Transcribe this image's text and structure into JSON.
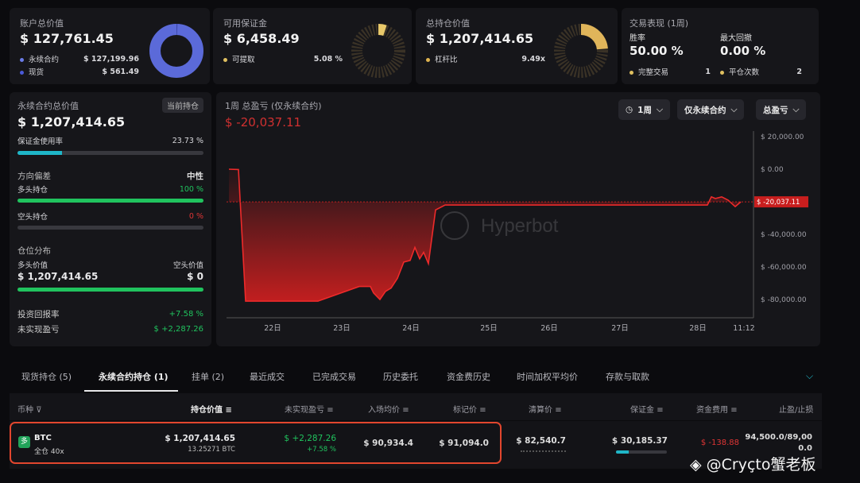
{
  "summary": {
    "account": {
      "title": "账户总价值",
      "value": "$ 127,761.45",
      "rows": [
        {
          "label": "永续合约",
          "value": "$ 127,199.96",
          "color": "#6a7ce8"
        },
        {
          "label": "现货",
          "value": "$ 561.49",
          "color": "#4a5ad8"
        }
      ]
    },
    "margin": {
      "title": "可用保证金",
      "value": "$ 6,458.49",
      "rows": [
        {
          "label": "可提取",
          "value": "5.08 %",
          "color": "#e0c060"
        }
      ]
    },
    "positions": {
      "title": "总持仓价值",
      "value": "$ 1,207,414.65",
      "rows": [
        {
          "label": "杠杆比",
          "value": "9.49x",
          "color": "#e0b450"
        }
      ]
    },
    "performance": {
      "title": "交易表现 (1周)",
      "win_label": "胜率",
      "win_value": "50.00 %",
      "dd_label": "最大回撤",
      "dd_value": "0.00 %",
      "completed_label": "完整交易",
      "completed_value": "1",
      "close_label": "平仓次数",
      "close_value": "2"
    }
  },
  "perp": {
    "title": "永续合约总价值",
    "badge": "当前持仓",
    "value": "$ 1,207,414.65",
    "margin_usage_label": "保证金使用率",
    "margin_usage_value": "23.73 %",
    "margin_usage_fraction": 0.2373,
    "bias_label": "方向偏差",
    "bias_value": "中性",
    "long_label": "多头持仓",
    "long_value": "100 %",
    "long_fraction": 1.0,
    "short_label": "空头持仓",
    "short_value": "0 %",
    "short_fraction": 0.0,
    "dist_label": "仓位分布",
    "long_val_label": "多头价值",
    "short_val_label": "空头价值",
    "long_val": "$ 1,207,414.65",
    "short_val": "$ 0",
    "dist_fraction": 1.0,
    "roi_label": "投资回报率",
    "roi_value": "+7.58 %",
    "upnl_label": "未实现盈亏",
    "upnl_value": "$ +2,287.26"
  },
  "chart_panel": {
    "title": "1周 总盈亏 (仅永续合约)",
    "value": "$ -20,037.11",
    "filters": [
      "1周",
      "仅永续合约",
      "总盈亏"
    ],
    "watermark": "Hyperbot",
    "current_label": "$ -20,037.11"
  },
  "chart_data": {
    "type": "area",
    "x_ticks": [
      "22日",
      "23日",
      "24日",
      "25日",
      "26日",
      "27日",
      "28日",
      "11:12"
    ],
    "y_ticks": [
      "$ 20,000.00",
      "$ 0.00",
      "$ -40,000.00",
      "$ -60,000.00",
      "$ -80,000.00"
    ],
    "y_tick_values": [
      20000,
      0,
      -40000,
      -60000,
      -80000
    ],
    "ylim": [
      -85000,
      25000
    ],
    "current_value": -20037.11,
    "values": [
      0,
      -200,
      -81000,
      -81000,
      -81000,
      -81000,
      -72000,
      -72000,
      -76000,
      -80000,
      -75000,
      -73000,
      -67000,
      -57000,
      -56000,
      -48000,
      -55000,
      -51000,
      -58000,
      -25000,
      -22000,
      -22000,
      -22000,
      -22000,
      -22000,
      -22000,
      -22000,
      -22000,
      -22000,
      -22000,
      -22000,
      -22000,
      -17000,
      -18000,
      -17000,
      -19000,
      -23000,
      -20037.11
    ]
  },
  "tabs": [
    "现货持仓 (5)",
    "永续合约持仓 (1)",
    "挂单 (2)",
    "最近成交",
    "已完成交易",
    "历史委托",
    "资金费历史",
    "时间加权平均价",
    "存款与取款"
  ],
  "table": {
    "headers": [
      "币种",
      "持仓价值",
      "未实现盈亏",
      "入场均价",
      "标记价",
      "清算价",
      "保证金",
      "资金费用",
      "止盈/止损"
    ],
    "row": {
      "coin": "BTC",
      "mode": "全仓 40x",
      "value": "$ 1,207,414.65",
      "size": "13.25271 BTC",
      "upnl": "$ +2,287.26",
      "upnl_pct": "+7.58 %",
      "entry": "$ 90,934.4",
      "mark": "$ 91,094.0",
      "liq": "$ 82,540.7",
      "margin": "$ 30,185.37",
      "funding": "$ -138.88",
      "tpsl": "94,500.0/89,000.0"
    }
  },
  "watermark_footer": "◈ @Cryçto蟹老板"
}
